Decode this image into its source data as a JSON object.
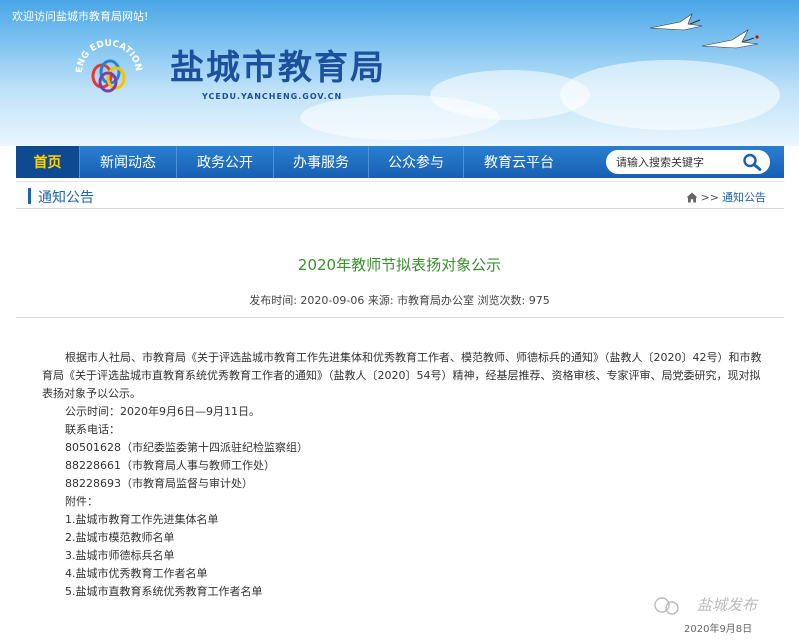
{
  "header": {
    "welcome": "欢迎访问盐城市教育局网站!",
    "site_title": "盐城市教育局",
    "site_domain": "YCEDU.YANCHENG.GOV.CN",
    "logo_ring_text": "ENG EDUCATION C"
  },
  "nav": {
    "items": [
      {
        "label": "首页"
      },
      {
        "label": "新闻动态"
      },
      {
        "label": "政务公开"
      },
      {
        "label": "办事服务"
      },
      {
        "label": "公众参与"
      },
      {
        "label": "教育云平台"
      }
    ],
    "search_placeholder": "请输入搜索关键字"
  },
  "crumb": {
    "section_title": "通知公告",
    "separator": ">>",
    "current": "通知公告"
  },
  "article": {
    "title": "2020年教师节拟表扬对象公示",
    "meta": "发布时间: 2020-09-06 来源: 市教育局办公室 浏览次数: 975",
    "paragraph_line1": "根据市人社局、市教育局《关于评选盐城市教育工作先进集体和优秀教育工作者、模范教师、师德标兵的通知》（盐教人〔2020〕42号）和市教",
    "paragraph_line2": "育局《关于评选盐城市直教育系统优秀教育工作者的通知》（盐教人〔2020〕54号）精神，经基层推荐、资格审核、专家评审、局党委研究，现对拟",
    "paragraph_line3": "表扬对象予以公示。",
    "lines": [
      "公示时间：2020年9月6日—9月11日。",
      "联系电话：",
      "80501628（市纪委监委第十四派驻纪检监察组）",
      "88228661（市教育局人事与教师工作处）",
      "88228693（市教育局监督与审计处）",
      "附件：",
      "1.盐城市教育工作先进集体名单",
      "2.盐城市模范教师名单",
      "3.盐城市师德标兵名单",
      "4.盐城市优秀教育工作者名单",
      "5.盐城市直教育系统优秀教育工作者名单"
    ]
  },
  "watermark": {
    "text": "盐城发布",
    "date": "2020年9月8日"
  },
  "colors": {
    "nav_bg": "#1760b2",
    "nav_active_text": "#ffd400",
    "title_green": "#3a8f2e",
    "brand_blue": "#1c4f9c"
  }
}
